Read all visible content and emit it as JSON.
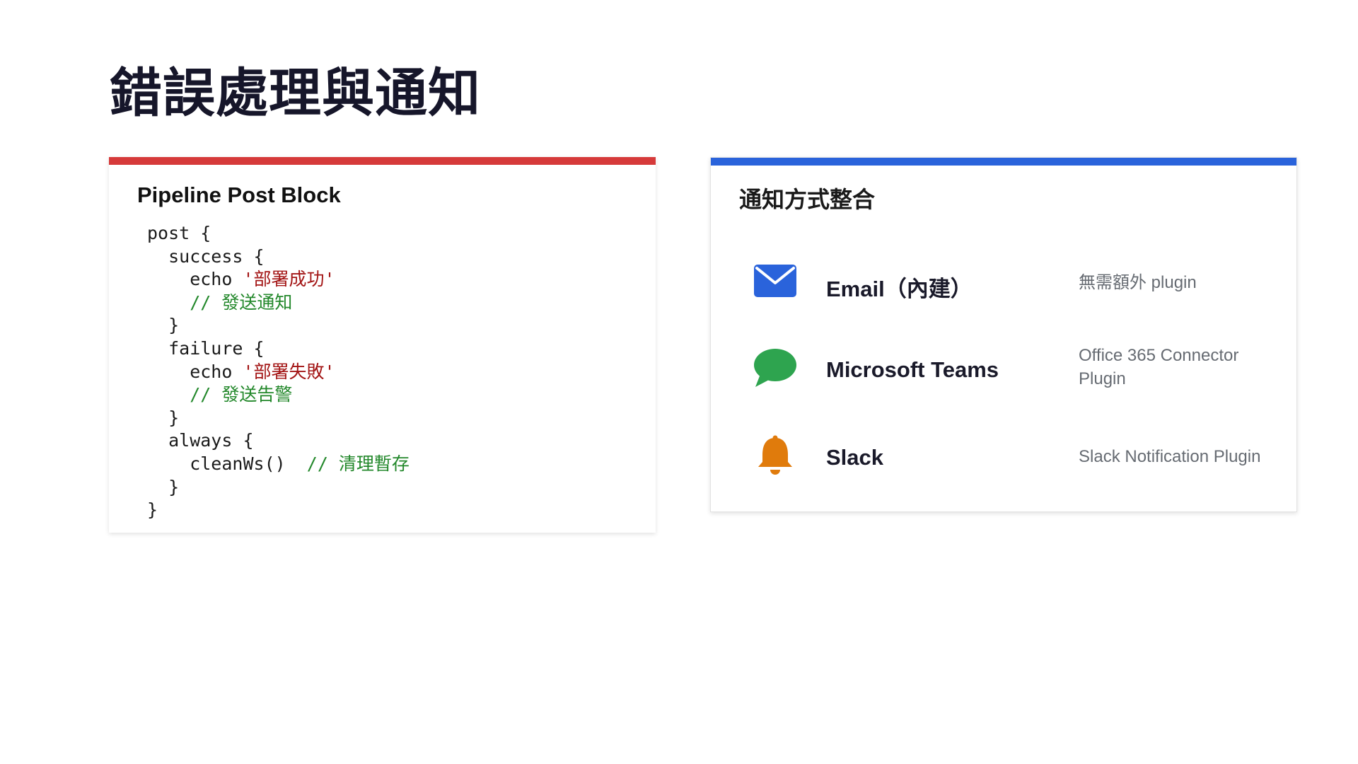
{
  "page": {
    "title": "錯誤處理與通知"
  },
  "pipeline_card": {
    "title": "Pipeline Post Block",
    "accent_color": "#d63a3a",
    "code": {
      "l1": "post {",
      "l2": "  success {",
      "l3_code": "    echo ",
      "l3_str": "'部署成功'",
      "l4": "    // 發送通知",
      "l5": "  }",
      "l6": "  failure {",
      "l7_code": "    echo ",
      "l7_str": "'部署失敗'",
      "l8": "    // 發送告警",
      "l9": "  }",
      "l10": "  always {",
      "l11_code": "    cleanWs()  ",
      "l11_comment": "// 清理暫存",
      "l12": "  }",
      "l13": "}"
    },
    "code_colors": {
      "string": "#a31515",
      "comment": "#23882b"
    }
  },
  "notify_card": {
    "title": "通知方式整合",
    "accent_color": "#2a63db",
    "items": [
      {
        "icon": "envelope-icon",
        "icon_color": "#2a63db",
        "name": "Email（內建）",
        "description": "無需額外 plugin"
      },
      {
        "icon": "chat-bubble-icon",
        "icon_color": "#2ea44f",
        "name": "Microsoft Teams",
        "description": "Office 365 Connector Plugin"
      },
      {
        "icon": "bell-icon",
        "icon_color": "#e07b0c",
        "name": "Slack",
        "description": "Slack Notification Plugin"
      }
    ]
  }
}
